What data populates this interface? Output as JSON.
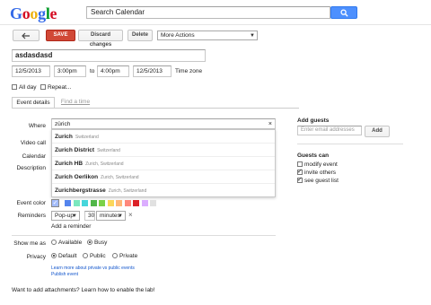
{
  "logo": {
    "letters": [
      "G",
      "o",
      "o",
      "g",
      "l",
      "e"
    ],
    "colors": [
      "#3369e8",
      "#d50f25",
      "#eeb211",
      "#3369e8",
      "#009925",
      "#d50f25"
    ]
  },
  "search": {
    "value": "Search Calendar",
    "icon": "search-icon"
  },
  "toolbar": {
    "back_icon": "back-arrow-icon",
    "save_label": "SAVE",
    "discard_label": "Discard changes",
    "delete_label": "Delete",
    "more_actions": "More Actions"
  },
  "event": {
    "title": "asdasdasd",
    "start_date": "12/5/2013",
    "start_time": "3:00pm",
    "to_label": "to",
    "end_time": "4:00pm",
    "end_date": "12/5/2013",
    "timezone_link": "Time zone",
    "all_day_label": "All day",
    "repeat_label": "Repeat..."
  },
  "tabs": {
    "details": "Event details",
    "find_time": "Find a time"
  },
  "form": {
    "where_label": "Where",
    "where_value": "zürich",
    "video_label": "Video call",
    "calendar_label": "Calendar",
    "description_label": "Description",
    "color_label": "Event color",
    "reminders_label": "Reminders",
    "reminder_type": "Pop-up",
    "reminder_amount": "30",
    "reminder_unit": "minutes",
    "add_reminder": "Add a reminder",
    "show_me_as_label": "Show me as",
    "available_label": "Available",
    "busy_label": "Busy",
    "privacy_label": "Privacy",
    "default_label": "Default",
    "public_label": "Public",
    "private_label": "Private",
    "learn_more": "Learn more about private vs public events",
    "publish_event": "Publish event",
    "attachments_link": "Want to add attachments? Learn how to enable the lab!"
  },
  "suggestions": [
    {
      "main": "Zurich",
      "sub": "Switzerland"
    },
    {
      "main": "Zurich District",
      "sub": "Switzerland"
    },
    {
      "main": "Zurich HB",
      "sub": "Zurich, Switzerland"
    },
    {
      "main": "Zurich Oerlikon",
      "sub": "Zurich, Switzerland"
    },
    {
      "main": "Zurichbergstrasse",
      "sub": "Zurich, Switzerland"
    }
  ],
  "colors": [
    "#a4bdfc",
    "#5484ed",
    "#7ae7bf",
    "#46d6db",
    "#51b749",
    "#7bd148",
    "#fbd75b",
    "#ffb878",
    "#ff887c",
    "#dc2127",
    "#dbadff",
    "#e1e1e1"
  ],
  "guests": {
    "add_title": "Add guests",
    "placeholder": "Enter email addresses",
    "add_button": "Add",
    "can_title": "Guests can",
    "modify": "modify event",
    "invite": "invite others",
    "see_list": "see guest list"
  }
}
